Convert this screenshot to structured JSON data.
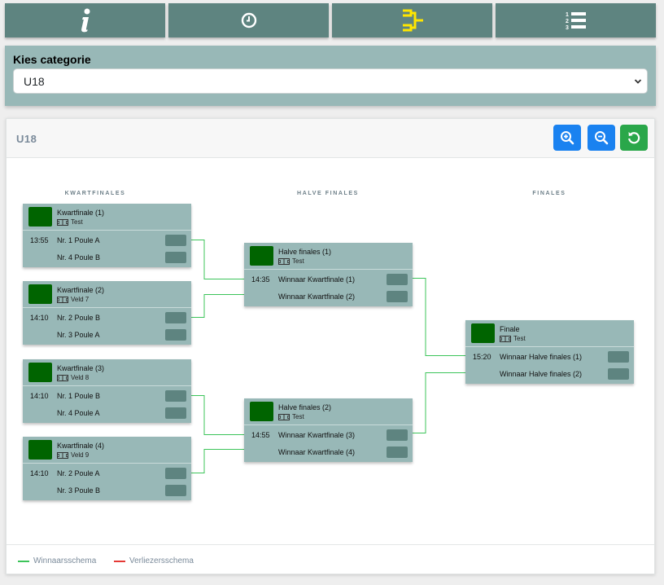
{
  "tabs": [
    {
      "name": "info-icon",
      "color": "#ffffff"
    },
    {
      "name": "clock-icon",
      "color": "#ffffff"
    },
    {
      "name": "bracket-icon",
      "color": "#ffe600",
      "active": true
    },
    {
      "name": "ranking-list-icon",
      "color": "#ffffff"
    }
  ],
  "category": {
    "label": "Kies categorie",
    "selected": "U18"
  },
  "bracket": {
    "title": "U18",
    "rounds": [
      "KWARTFINALES",
      "HALVE FINALES",
      "FINALES"
    ],
    "matches": {
      "qf1": {
        "name": "Kwartfinale (1)",
        "field": "Test",
        "time": "13:55",
        "team1": "Nr. 1 Poule A",
        "team2": "Nr. 4 Poule B"
      },
      "qf2": {
        "name": "Kwartfinale (2)",
        "field": "Veld 7",
        "time": "14:10",
        "team1": "Nr. 2 Poule B",
        "team2": "Nr. 3 Poule A"
      },
      "qf3": {
        "name": "Kwartfinale (3)",
        "field": "Veld 8",
        "time": "14:10",
        "team1": "Nr. 1 Poule B",
        "team2": "Nr. 4 Poule A"
      },
      "qf4": {
        "name": "Kwartfinale (4)",
        "field": "Veld 9",
        "time": "14:10",
        "team1": "Nr. 2 Poule A",
        "team2": "Nr. 3 Poule B"
      },
      "sf1": {
        "name": "Halve finales (1)",
        "field": "Test",
        "time": "14:35",
        "team1": "Winnaar Kwartfinale (1)",
        "team2": "Winnaar Kwartfinale (2)"
      },
      "sf2": {
        "name": "Halve finales (2)",
        "field": "Test",
        "time": "14:55",
        "team1": "Winnaar Kwartfinale (3)",
        "team2": "Winnaar Kwartfinale (4)"
      },
      "f1": {
        "name": "Finale",
        "field": "Test",
        "time": "15:20",
        "team1": "Winnaar Halve finales (1)",
        "team2": "Winnaar Halve finales (2)"
      }
    },
    "legend": {
      "winners": "Winnaarsschema",
      "winners_color": "#3cc45a",
      "losers": "Verliezersschema",
      "losers_color": "#e53935"
    }
  }
}
